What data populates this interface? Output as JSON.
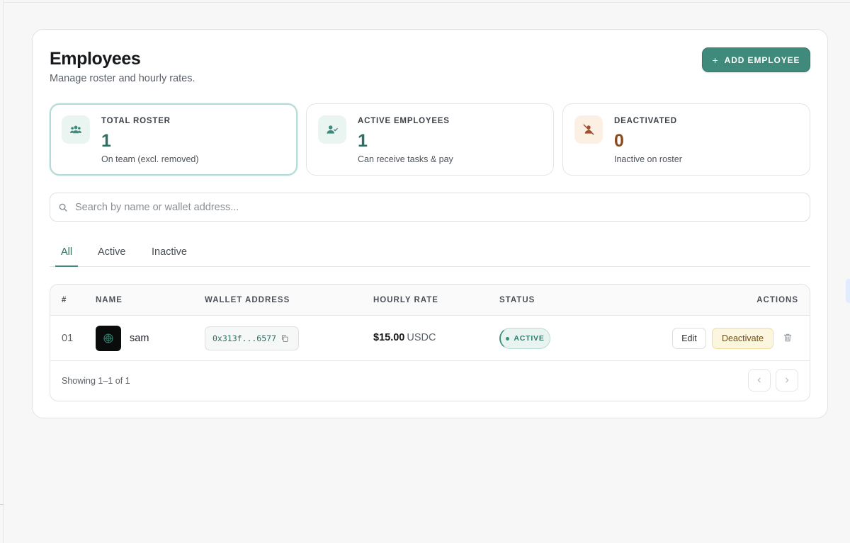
{
  "header": {
    "title": "Employees",
    "subtitle": "Manage roster and hourly rates.",
    "add_button_label": "ADD EMPLOYEE",
    "add_button_icon": "plus-icon"
  },
  "stats": [
    {
      "label": "TOTAL ROSTER",
      "value": "1",
      "description": "On team (excl. removed)",
      "icon": "users-icon"
    },
    {
      "label": "ACTIVE EMPLOYEES",
      "value": "1",
      "description": "Can receive tasks & pay",
      "icon": "user-check-icon"
    },
    {
      "label": "DEACTIVATED",
      "value": "0",
      "description": "Inactive on roster",
      "icon": "user-off-icon"
    }
  ],
  "search": {
    "placeholder": "Search by name or wallet address...",
    "value": "",
    "icon": "search-icon"
  },
  "tabs": [
    {
      "label": "All",
      "selected": true
    },
    {
      "label": "Active",
      "selected": false
    },
    {
      "label": "Inactive",
      "selected": false
    }
  ],
  "table": {
    "headers": [
      "#",
      "NAME",
      "WALLET ADDRESS",
      "HOURLY RATE",
      "STATUS",
      "ACTIONS"
    ],
    "rows": [
      {
        "index": "01",
        "name": "sam",
        "wallet": "0x313f...6577",
        "rate_amount": "$15.00",
        "rate_currency": "USDC",
        "status": "ACTIVE",
        "edit_label": "Edit",
        "deactivate_label": "Deactivate"
      }
    ],
    "footer": "Showing 1–1 of 1"
  },
  "colors": {
    "accent": "#3f8a7a",
    "active_badge": "#e9f4f1",
    "deactivate_bg": "#fdf6df",
    "deactivated_value": "#8a4a1e"
  }
}
